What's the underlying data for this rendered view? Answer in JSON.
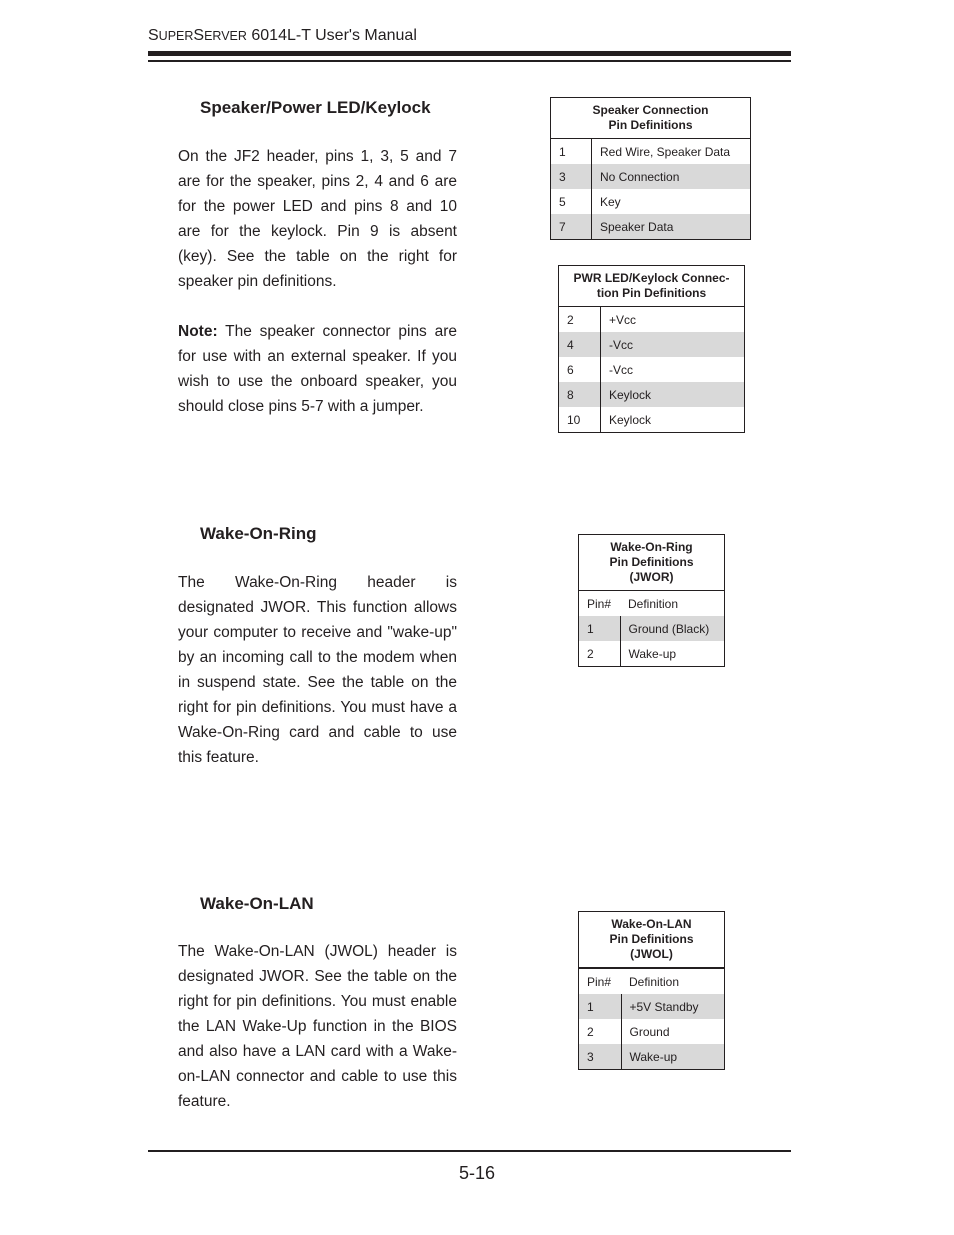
{
  "header": {
    "title_cap1": "S",
    "title_small1": "UPER",
    "title_cap2": "S",
    "title_small2": "ERVER",
    "title_rest": " 6014L-T User's Manual"
  },
  "sections": [
    {
      "heading": "Speaker/Power LED/Keylock",
      "paragraphs": [
        "On the JF2 header, pins 1, 3, 5 and 7  are for the speaker, pins 2, 4 and 6 are for the power LED and pins 8 and 10 are for the keylock.  Pin 9 is absent (key). See the table on the right for speaker pin definitions."
      ],
      "note_label": "Note:",
      "note_text": " The speaker connector pins are for use with an external speaker.  If you wish to use the onboard speaker, you should close pins 5-7 with a jumper."
    },
    {
      "heading": "Wake-On-Ring",
      "paragraphs": [
        "The Wake-On-Ring header is designated JWOR.  This function allows your computer to receive and \"wake-up\" by an incoming call to the modem when in suspend state.  See the table on the right for pin definitions.  You must have a Wake-On-Ring card and cable to use this feature."
      ]
    },
    {
      "heading": "Wake-On-LAN",
      "paragraphs": [
        "The Wake-On-LAN (JWOL) header is designated JWOR.  See the table on the right for pin definitions.  You must enable the LAN Wake-Up function in the BIOS and also have a LAN card with a Wake-on-LAN connector and cable to use this feature."
      ]
    }
  ],
  "tables": {
    "speaker": {
      "title_line1": "Speaker Connection",
      "title_line2": "Pin Definitions",
      "rows": [
        {
          "pin": "1",
          "definition": "Red Wire, Speaker Data"
        },
        {
          "pin": "3",
          "definition": "No Connection"
        },
        {
          "pin": "5",
          "definition": "Key"
        },
        {
          "pin": "7",
          "definition": "Speaker Data"
        }
      ]
    },
    "pwr_led": {
      "title_line1": "PWR LED/Keylock Connec-",
      "title_line2": "tion Pin Definitions",
      "rows": [
        {
          "pin": "2",
          "definition": "+Vcc"
        },
        {
          "pin": "4",
          "definition": "-Vcc"
        },
        {
          "pin": "6",
          "definition": "-Vcc"
        },
        {
          "pin": "8",
          "definition": "Keylock"
        },
        {
          "pin": "10",
          "definition": "Keylock"
        }
      ]
    },
    "wor": {
      "title_line1": "Wake-On-Ring",
      "title_line2": "Pin Definitions",
      "title_line3": "(JWOR)",
      "col_pin": "Pin#",
      "col_def": "Definition",
      "rows": [
        {
          "pin": "1",
          "definition": "Ground (Black)"
        },
        {
          "pin": "2",
          "definition": "Wake-up"
        }
      ]
    },
    "wol": {
      "title_line1": "Wake-On-LAN",
      "title_line2": "Pin Definitions",
      "title_line3": "(JWOL)",
      "col_pin": "Pin#",
      "col_def": "Definition",
      "rows": [
        {
          "pin": "1",
          "definition": "+5V Standby"
        },
        {
          "pin": "2",
          "definition": "Ground"
        },
        {
          "pin": "3",
          "definition": "Wake-up"
        }
      ]
    }
  },
  "footer": {
    "page_number": "5-16"
  },
  "colors": {
    "text": "#231f20",
    "row_shade": "#d9d9d9"
  }
}
